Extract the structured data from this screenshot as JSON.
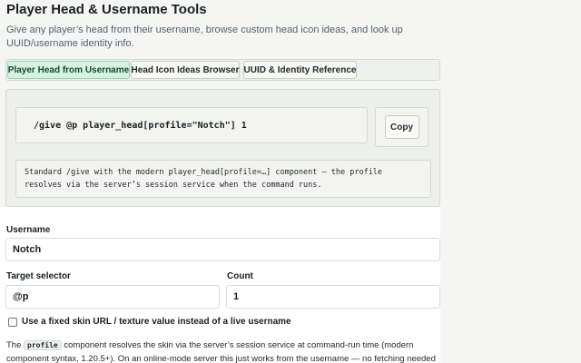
{
  "header": {
    "title": "Player Head & Username Tools",
    "description": "Give any player’s head from their username, browse custom head icon ideas, and look up UUID/username identity info."
  },
  "tabs": [
    {
      "label": "Player Head from Username",
      "active": true
    },
    {
      "label": "Head Icon Ideas Browser",
      "active": false
    },
    {
      "label": "UUID & Identity Reference",
      "active": false
    }
  ],
  "command": {
    "text": "/give @p player_head[profile=\"Notch\"] 1",
    "copy_label": "Copy",
    "note": "Standard /give with the modern player_head[profile=…] component — the profile resolves via the server’s session service when the command runs."
  },
  "form": {
    "username_label": "Username",
    "username_value": "Notch",
    "selector_label": "Target selector",
    "selector_value": "@p",
    "count_label": "Count",
    "count_value": "1",
    "fixed_skin_label": "Use a fixed skin URL / texture value instead of a live username",
    "fixed_skin_checked": false
  },
  "footnote": {
    "prefix": "The",
    "code": "profile",
    "suffix": "component resolves the skin via the server’s session service at command-run time (modern component syntax, 1.20.5+). On an online-mode server this just works from the username — no fetching needed on your end."
  }
}
